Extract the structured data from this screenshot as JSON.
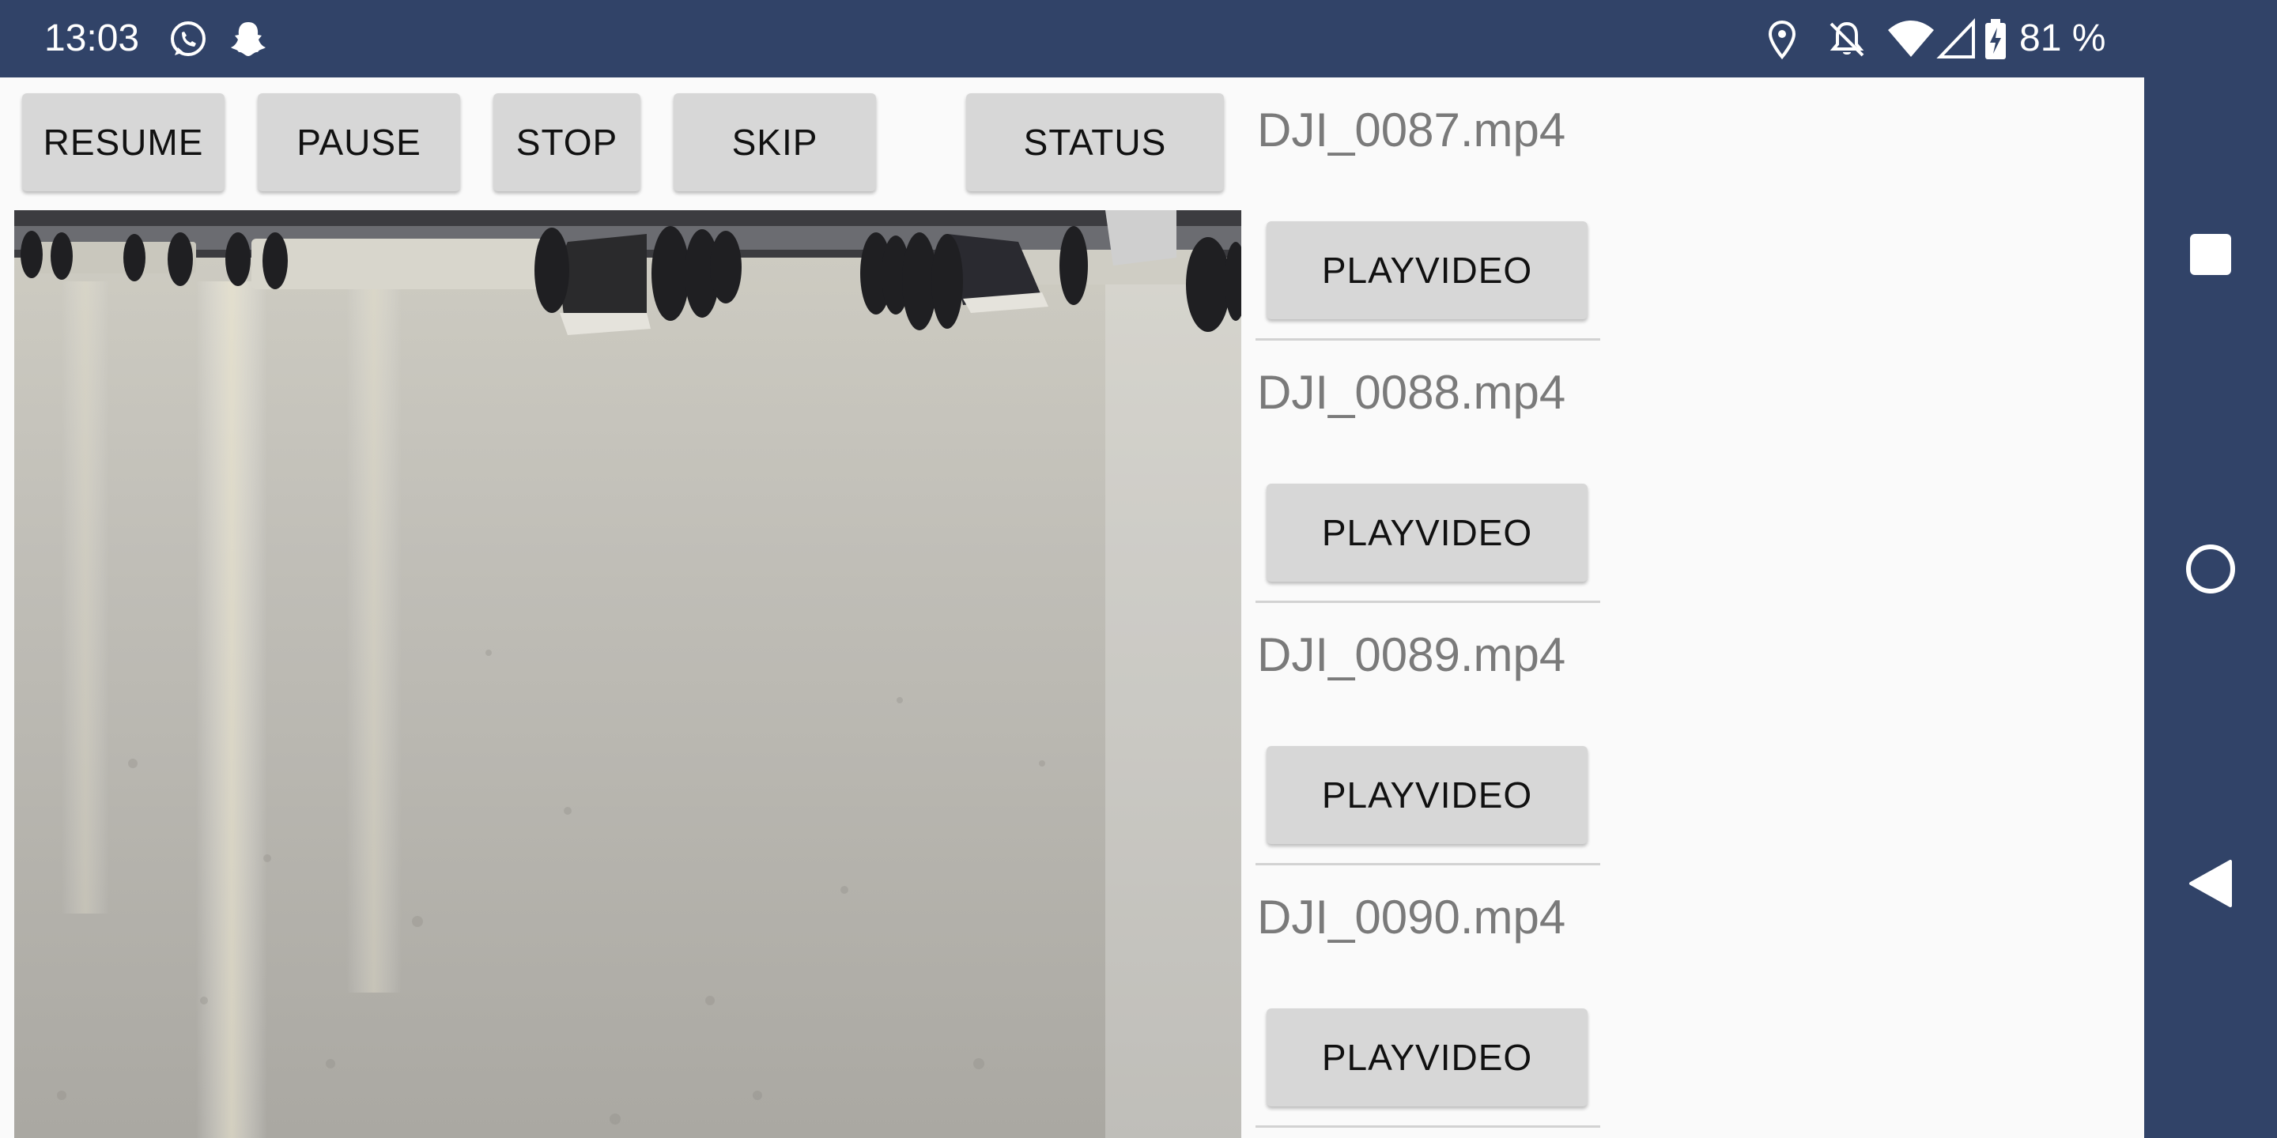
{
  "status_bar": {
    "time": "13:03",
    "battery_percent": "81 %",
    "icons": [
      "whatsapp-icon",
      "snapchat-icon",
      "location-icon",
      "notifications-off-icon",
      "wifi-icon",
      "signal-icon",
      "battery-charging-icon"
    ]
  },
  "controls": {
    "resume_label": "RESUME",
    "pause_label": "PAUSE",
    "stop_label": "STOP",
    "skip_label": "SKIP",
    "status_label": "STATUS"
  },
  "videos": [
    {
      "filename": "DJI_0087.mp4",
      "button_label": "PLAYVIDEO"
    },
    {
      "filename": "DJI_0088.mp4",
      "button_label": "PLAYVIDEO"
    },
    {
      "filename": "DJI_0089.mp4",
      "button_label": "PLAYVIDEO"
    },
    {
      "filename": "DJI_0090.mp4",
      "button_label": "PLAYVIDEO"
    }
  ],
  "navigation": {
    "icons": [
      "recents-square-icon",
      "home-circle-icon",
      "back-triangle-icon"
    ]
  },
  "colors": {
    "system_bar": "#314368",
    "button": "#d7d7d7",
    "label_gray": "#7a7a7a"
  }
}
